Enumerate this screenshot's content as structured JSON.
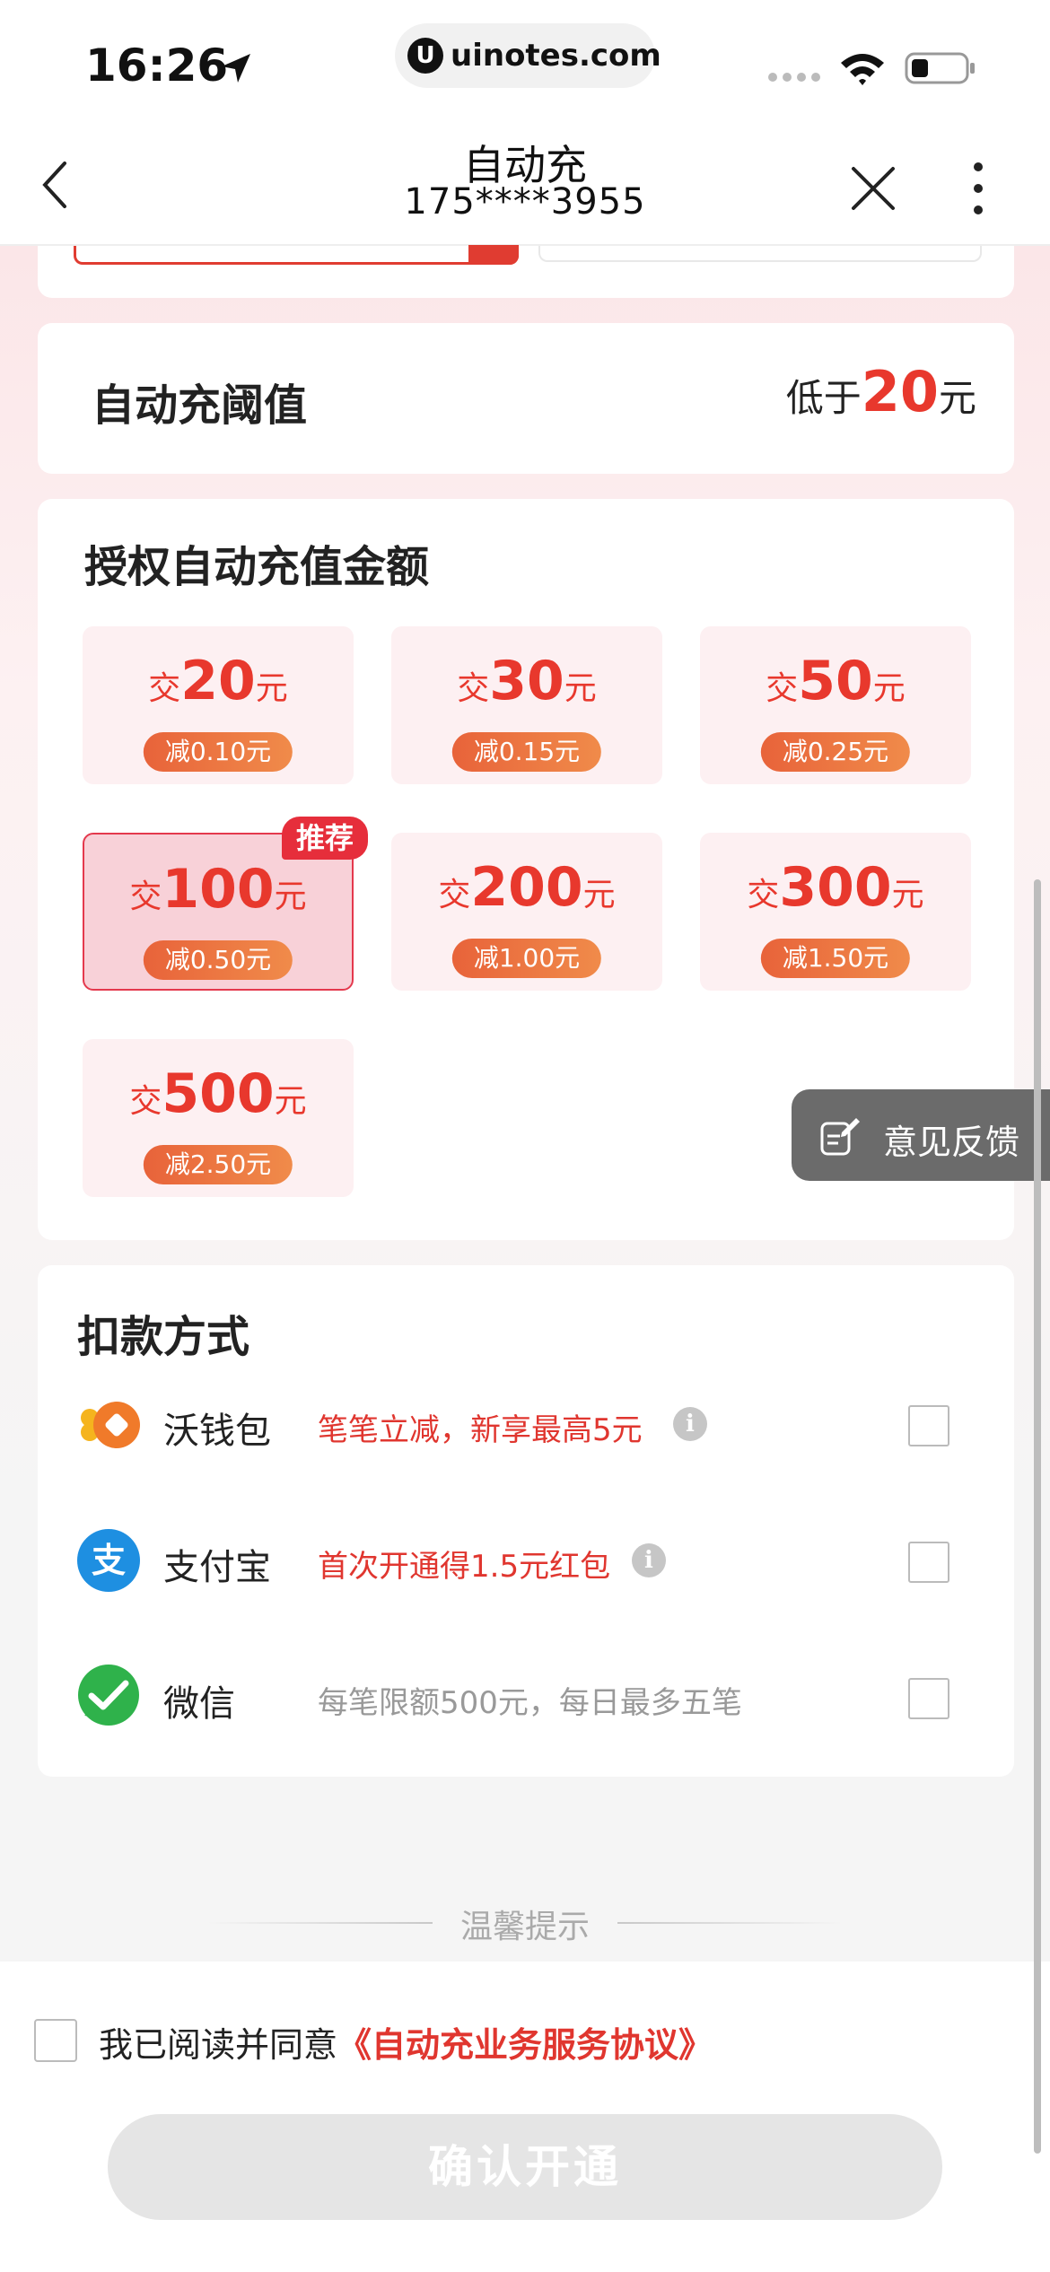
{
  "status_bar": {
    "time": "16:26",
    "url": "uinotes.com",
    "url_icon": "U"
  },
  "nav": {
    "title": "自动充",
    "phone": "175****3955"
  },
  "threshold": {
    "label": "自动充阈值",
    "prefix": "低于",
    "value": "20",
    "unit": "元"
  },
  "amounts": {
    "title": "授权自动充值金额",
    "prefix": "交",
    "unit": "元",
    "badge": "推荐",
    "options": [
      {
        "amount": "20",
        "discount": "减0.10元",
        "selected": false
      },
      {
        "amount": "30",
        "discount": "减0.15元",
        "selected": false
      },
      {
        "amount": "50",
        "discount": "减0.25元",
        "selected": false
      },
      {
        "amount": "100",
        "discount": "减0.50元",
        "selected": true
      },
      {
        "amount": "200",
        "discount": "减1.00元",
        "selected": false
      },
      {
        "amount": "300",
        "discount": "减1.50元",
        "selected": false
      },
      {
        "amount": "500",
        "discount": "减2.50元",
        "selected": false
      }
    ]
  },
  "feedback": {
    "label": "意见反馈"
  },
  "payment": {
    "title": "扣款方式",
    "methods": [
      {
        "name": "沃钱包",
        "promo": "笔笔立减，新享最高5元",
        "info": "i",
        "icon": "wo-wallet-icon"
      },
      {
        "name": "支付宝",
        "promo": "首次开通得1.5元红包",
        "info": "i",
        "icon": "alipay-icon",
        "icon_char": "支"
      },
      {
        "name": "微信",
        "promo": "每笔限额500元，每日最多五笔",
        "icon": "wechat-icon"
      }
    ]
  },
  "tips": {
    "label": "温馨提示"
  },
  "agreement": {
    "text": "我已阅读并同意",
    "link": "《自动充业务服务协议》"
  },
  "confirm": {
    "label": "确认开通"
  },
  "colors": {
    "accent": "#e8382d",
    "selected_bg": "#f8d1d8",
    "discount_pill": "#ec7540",
    "button_disabled": "#e5e5e5"
  }
}
